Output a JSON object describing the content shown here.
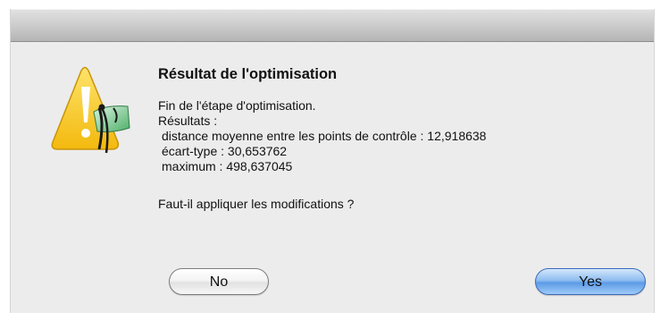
{
  "dialog": {
    "title": "Résultat de l'optimisation",
    "message_lines": [
      "Fin de l'étape d'optimisation.",
      "Résultats :",
      "distance moyenne entre les points de contrôle : 12,918638",
      "écart-type : 30,653762",
      "maximum : 498,637045"
    ],
    "question": "Faut-il appliquer les modifications ?",
    "icon": "warning-triangle-app-icon",
    "buttons": {
      "no_label": "No",
      "yes_label": "Yes"
    }
  },
  "colors": {
    "dialog_background": "#ececec",
    "warning_yellow": "#f5c518",
    "default_button_blue": "#5c9be6"
  }
}
